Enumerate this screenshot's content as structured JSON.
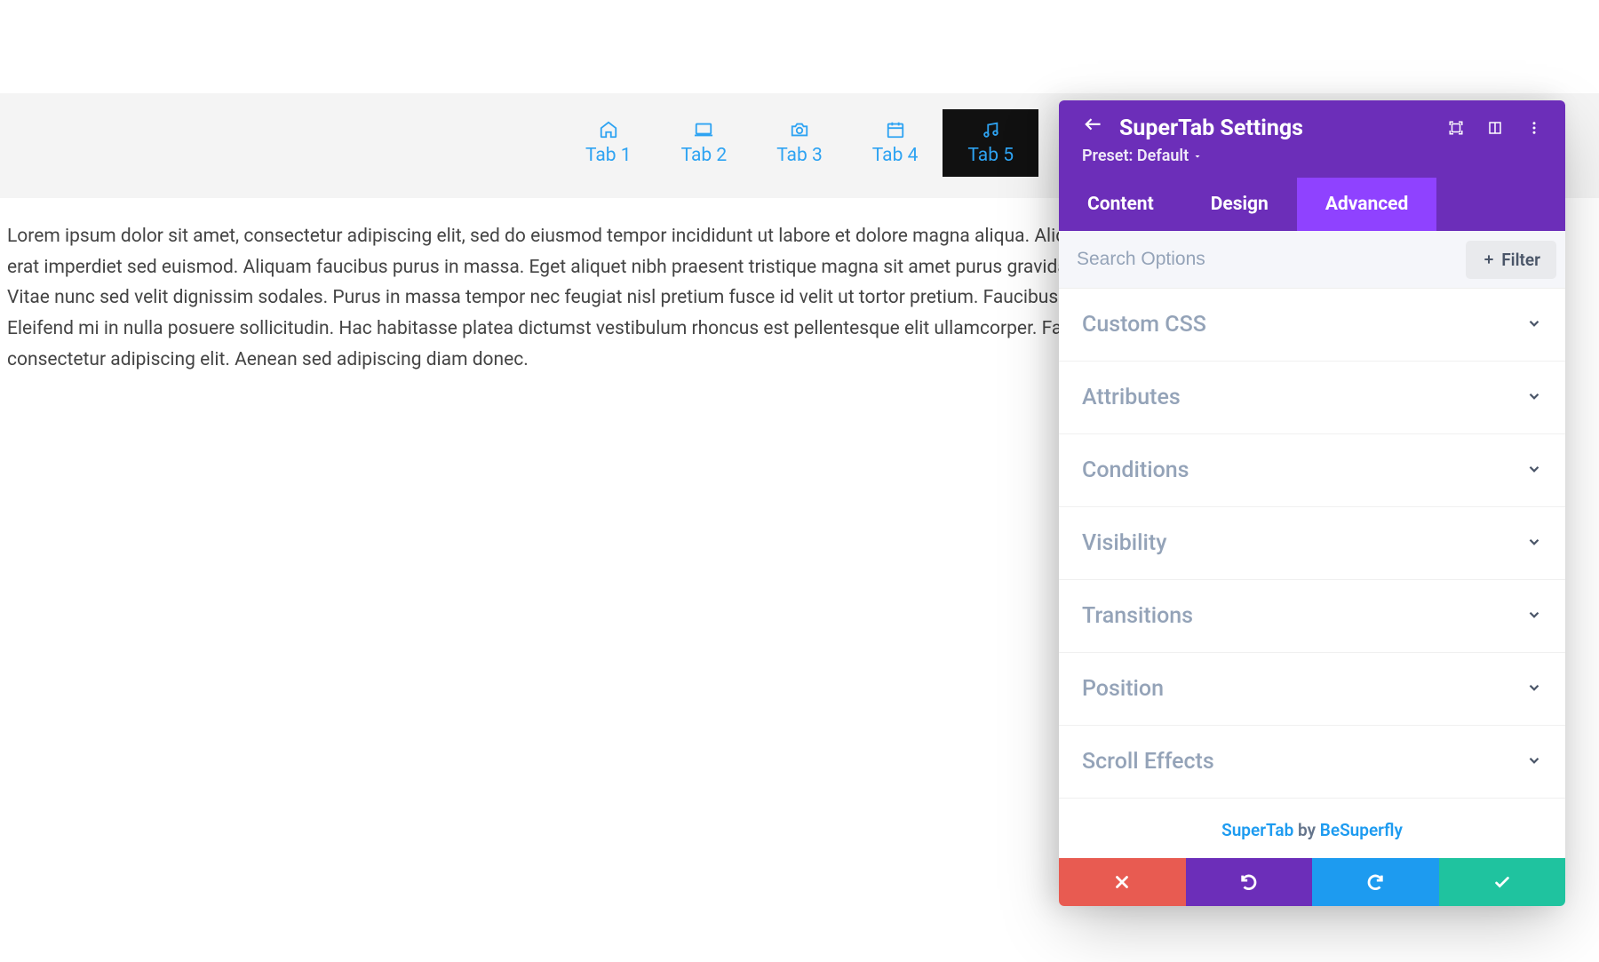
{
  "main": {
    "tabs": [
      {
        "label": "Tab 1",
        "icon": "home"
      },
      {
        "label": "Tab 2",
        "icon": "laptop"
      },
      {
        "label": "Tab 3",
        "icon": "camera"
      },
      {
        "label": "Tab 4",
        "icon": "calendar"
      },
      {
        "label": "Tab 5",
        "icon": "music",
        "active": true
      }
    ],
    "content": "Lorem ipsum dolor sit amet, consectetur adipiscing elit, sed do eiusmod tempor incididunt ut labore et dolore magna aliqua. Aliquet nibh praesent tristique magna sit amet purus. In egestas erat imperdiet sed euismod. Aliquam faucibus purus in massa. Eget aliquet nibh praesent tristique magna sit amet purus gravida. Pulvinar neque laoreet suspendisse interdum consectetur. Vitae nunc sed velit dignissim sodales. Purus in massa tempor nec feugiat nisl pretium fusce id velit ut tortor pretium. Faucibus vitae aliquet nec ullamcorper sit amet risus nullam eget. Eleifend mi in nulla posuere sollicitudin. Hac habitasse platea dictumst vestibulum rhoncus est pellentesque elit ullamcorper. Facilisis mauris sit amet. Posuere lorem ipsum dolor sit amet consectetur adipiscing elit. Aenean sed adipiscing diam donec."
  },
  "panel": {
    "title": "SuperTab Settings",
    "preset_label": "Preset: Default",
    "tabs": [
      {
        "label": "Content"
      },
      {
        "label": "Design"
      },
      {
        "label": "Advanced",
        "active": true
      }
    ],
    "search_placeholder": "Search Options",
    "filter_label": "Filter",
    "sections": [
      {
        "label": "Custom CSS"
      },
      {
        "label": "Attributes"
      },
      {
        "label": "Conditions"
      },
      {
        "label": "Visibility"
      },
      {
        "label": "Transitions"
      },
      {
        "label": "Position"
      },
      {
        "label": "Scroll Effects"
      }
    ],
    "credit": {
      "product": "SuperTab",
      "middle": " by ",
      "author": "BeSuperfly"
    }
  }
}
